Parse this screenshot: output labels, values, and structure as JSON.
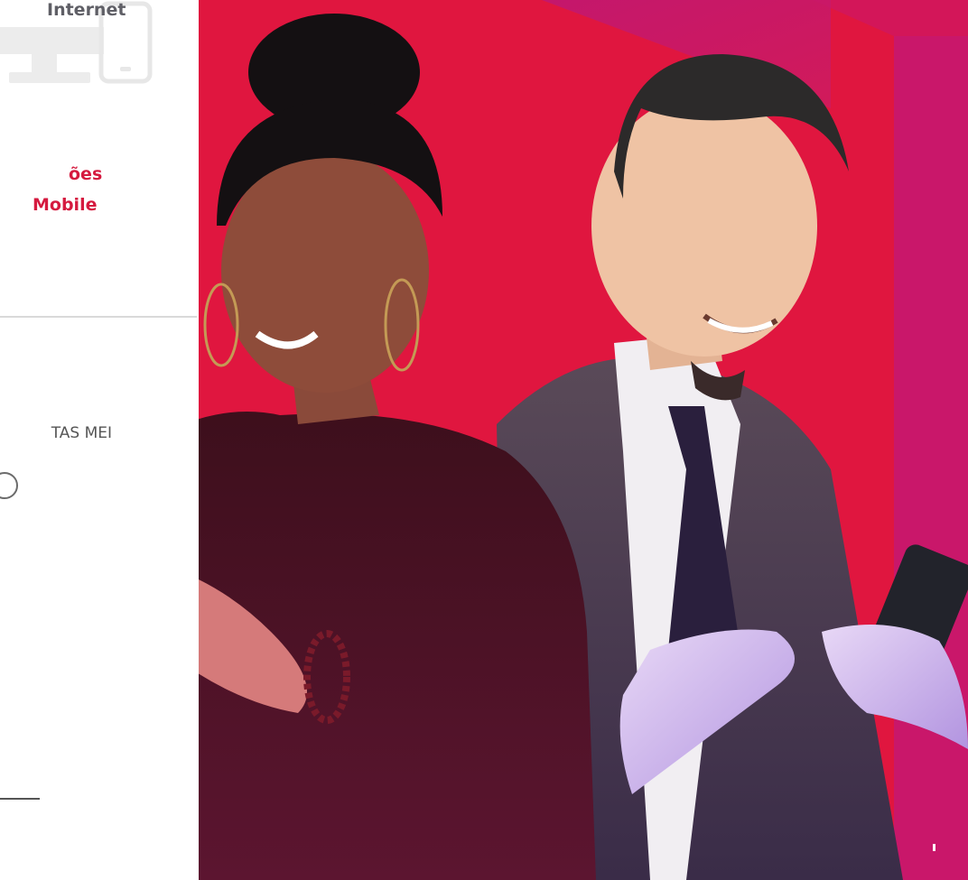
{
  "left_panel": {
    "title": "Internet",
    "subtitle_line1": "ões",
    "subtitle_line2": "Mobile",
    "label": "TAS MEI",
    "icon": "desktop-mobile-icon"
  },
  "hero": {
    "people": [
      "woman-with-smartphone",
      "man-with-smartphone"
    ]
  },
  "colors": {
    "brand_red": "#e0163f",
    "magenta": "#c9176a",
    "subtitle_red": "#d51a3f",
    "text_gray": "#5f5f66"
  }
}
